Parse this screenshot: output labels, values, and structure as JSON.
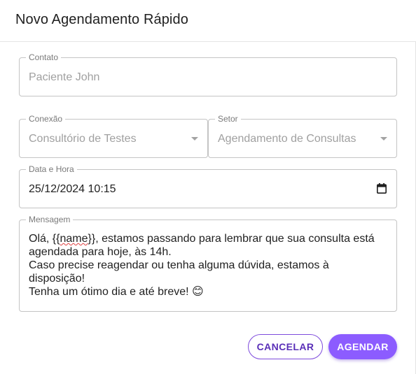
{
  "dialog": {
    "title": "Novo Agendamento Rápido"
  },
  "form": {
    "contact": {
      "label": "Contato",
      "value": "Paciente John"
    },
    "connection": {
      "label": "Conexão",
      "value": "Consultório de Testes"
    },
    "sector": {
      "label": "Setor",
      "value": "Agendamento de Consultas"
    },
    "datetime": {
      "label": "Data e Hora",
      "value": "25/12/2024 10:15"
    },
    "message": {
      "label": "Mensagem",
      "line1_pre": "Olá, {{",
      "line1_var": "name",
      "line1_post": "}}, estamos passando para lembrar que sua consulta está agendada para hoje, às 14h.",
      "line2": "Caso precise reagendar ou tenha alguma dúvida, estamos à disposição!",
      "line3": "Tenha um ótimo dia e até breve! 😊"
    }
  },
  "actions": {
    "cancel_label": "CANCELAR",
    "submit_label": "AGENDAR"
  },
  "colors": {
    "accent": "#8c5cff",
    "accent_dark": "#5a2fb8",
    "border": "#c4c4c4",
    "label": "#7a7a7a"
  },
  "icons": {
    "select_caret": "chevron-down-icon",
    "date_picker": "calendar-icon"
  }
}
